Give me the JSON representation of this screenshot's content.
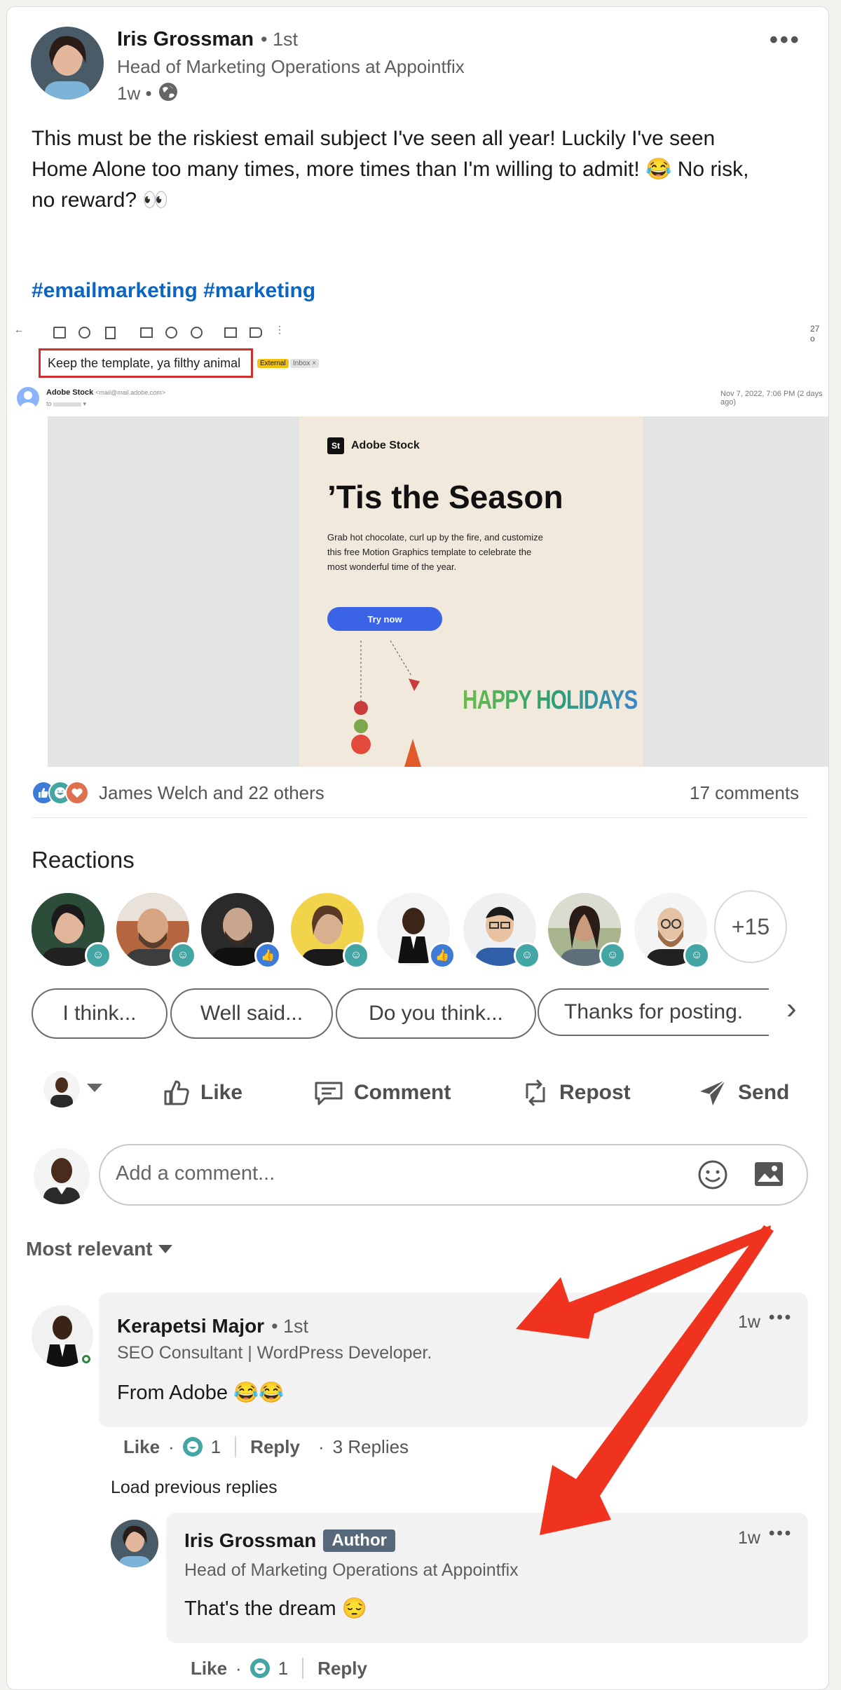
{
  "post": {
    "author": {
      "name": "Iris Grossman",
      "degree": "• 1st",
      "headline": "Head of Marketing Operations at Appointfix",
      "time": "1w •"
    },
    "menu_label": "•••",
    "text_line1": "This must be the riskiest email subject I've seen all year! Luckily I've seen",
    "text_line2": "Home Alone too many times, more times than I'm willing to admit! 😂 No risk,",
    "text_line3": "no reward? 👀",
    "hashtags": "#emailmarketing #marketing"
  },
  "email_preview": {
    "subject": "Keep the template, ya filthy animal",
    "tag_external": "External",
    "tag_inbox": "Inbox ×",
    "sender": "Adobe Stock",
    "sender_email": "<mail@mail.adobe.com>",
    "to": "to",
    "date": "Nov 7, 2022, 7:06 PM (2 days ago)",
    "page_count": "27 o",
    "brand": "Adobe Stock",
    "brand_logo": "St",
    "headline": "’Tis the Season",
    "body": "Grab hot chocolate, curl up by the fire, and customize this free Motion Graphics template to celebrate the most wonderful time of the year.",
    "cta": "Try now",
    "holiday": "HAPPY HOLIDAYS"
  },
  "social": {
    "reactors": "James Welch and 22 others",
    "comments": "17 comments"
  },
  "reactions": {
    "title": "Reactions",
    "more": "+15",
    "badges": [
      "laugh",
      "laugh",
      "like",
      "laugh",
      "like",
      "laugh",
      "laugh",
      "laugh"
    ]
  },
  "suggestions": [
    "I think...",
    "Well said...",
    "Do you think...",
    "Thanks for posting."
  ],
  "suggestion_next": "›",
  "actions": {
    "like": "Like",
    "comment": "Comment",
    "repost": "Repost",
    "send": "Send"
  },
  "composer": {
    "placeholder": "Add a comment..."
  },
  "sort": {
    "label": "Most relevant"
  },
  "comments": [
    {
      "name": "Kerapetsi Major",
      "degree": "• 1st",
      "headline": "SEO Consultant | WordPress Developer.",
      "text": "From Adobe 😂😂",
      "time": "1w",
      "like": "Like",
      "reaction_count": "1",
      "reply": "Reply",
      "replies": "3 Replies"
    }
  ],
  "load_previous": "Load previous replies",
  "reply": {
    "name": "Iris Grossman",
    "badge": "Author",
    "headline": "Head of Marketing Operations at Appointfix",
    "text": "That's the dream 😔",
    "time": "1w",
    "like": "Like",
    "reaction_count": "1",
    "reply": "Reply"
  },
  "separator_dot": "·",
  "menu_dots": "•••",
  "colors": {
    "link": "#0a66c2",
    "arrow": "#f0331e",
    "cta": "#3b63e6",
    "online": "#2e8540"
  }
}
